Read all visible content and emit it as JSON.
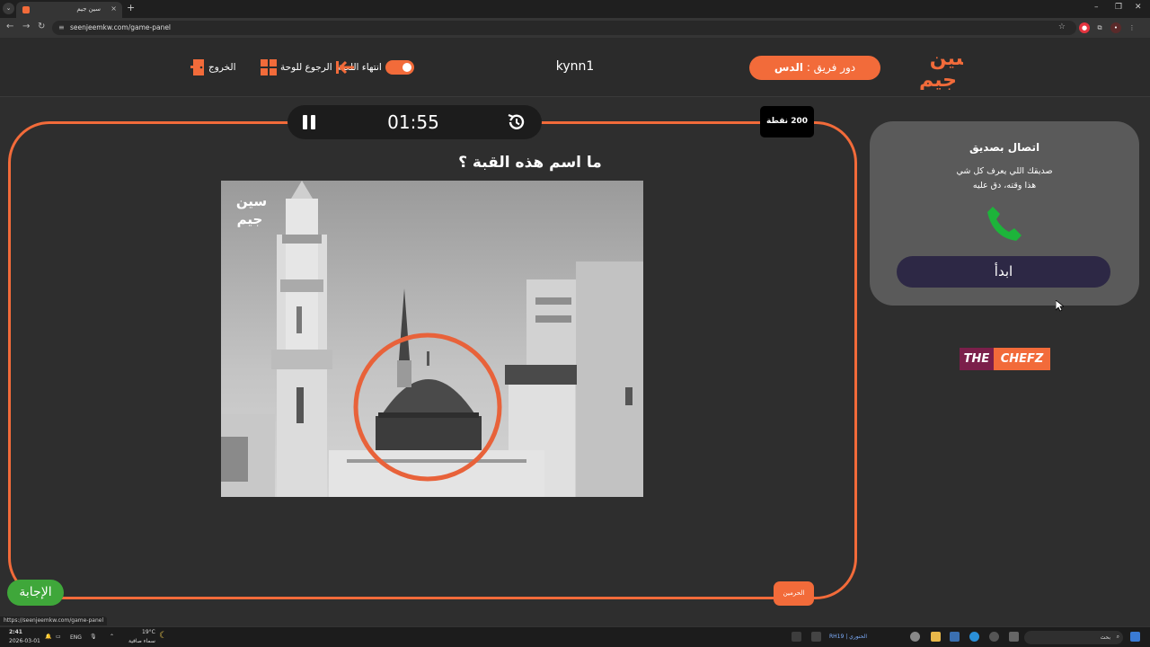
{
  "browser": {
    "tab_title": "سين جيم",
    "tab_close": "×",
    "new_tab": "+",
    "url": "seenjeemkw.com/game-panel",
    "status_url": "https://seenjeemkw.com/game-panel",
    "window_controls": [
      "–",
      "❐",
      "✕"
    ]
  },
  "header": {
    "team_label": "دور فريق :",
    "team_name": "الدس",
    "username": "kynn1",
    "end_game_label": "انتهاء اللعبة",
    "back_to_board_label": "الرجوع للوحة",
    "exit_label": "الخروج"
  },
  "game": {
    "timer": "01:55",
    "points": "200 نقطة",
    "question": "ما اسم هذه القبة ؟",
    "category": "الحرمين",
    "answer_button": "الإجابة"
  },
  "lifeline": {
    "title": "اتصال بصديق",
    "description_line1": "صديقك اللي يعرف كل شي",
    "description_line2": "هذا وقته، دق عليه",
    "start_button": "ابدأ"
  },
  "sponsor": {
    "part1": "THE",
    "part2": "CHEFZ"
  },
  "taskbar": {
    "time": "2:41",
    "date": "2026-03-01",
    "language": "ENG",
    "weather_temp": "19°C",
    "weather_desc": "سماء صافية",
    "search_placeholder": "بحث",
    "app_text": "RH19 | الحنوري"
  },
  "colors": {
    "accent": "#f26b3a",
    "answer": "#3fa73a",
    "start_button": "#2d2845",
    "panel": "#5a5a5a"
  }
}
